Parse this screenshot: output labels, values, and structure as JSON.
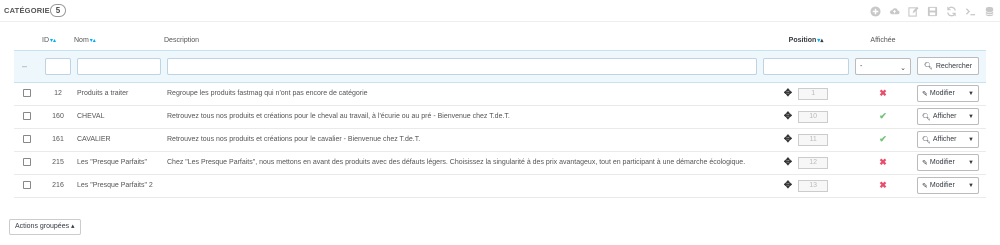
{
  "header": {
    "title": "CATÉGORIES",
    "count": "5"
  },
  "toolbar": {
    "icons": [
      "add-icon",
      "cloud-upload-icon",
      "edit-icon",
      "save-icon",
      "refresh-icon",
      "terminal-icon",
      "database-icon"
    ]
  },
  "columns": {
    "id": "ID",
    "name": "Nom",
    "description": "Description",
    "position": "Position",
    "displayed": "Affichée"
  },
  "filter": {
    "dash": "–",
    "select_value": "-",
    "search_label": "Rechercher"
  },
  "rows": [
    {
      "id": "12",
      "name": "Produits a traiter",
      "description": "Regroupe les produits fastmag qui n'ont pas encore de catégorie",
      "position": "1",
      "displayed": "✖",
      "action": "Modifier",
      "displayed_state": "no"
    },
    {
      "id": "160",
      "name": "CHEVAL",
      "description": "Retrouvez tous nos produits et créations pour le cheval au travail, à l'écurie ou au pré - Bienvenue chez T.de.T.",
      "position": "10",
      "displayed": "✔",
      "action": "Afficher",
      "displayed_state": "yes"
    },
    {
      "id": "161",
      "name": "CAVALIER",
      "description": "Retrouvez tous nos produits et créations pour le cavalier - Bienvenue chez T.de.T.",
      "position": "11",
      "displayed": "✔",
      "action": "Afficher",
      "displayed_state": "yes"
    },
    {
      "id": "215",
      "name": "Les \"Presque Parfaits\"",
      "description": "Chez \"Les Presque Parfaits\", nous mettons en avant des produits avec des défauts légers. Choisissez la singularité à des prix avantageux, tout en participant à une démarche écologique.",
      "position": "12",
      "displayed": "✖",
      "action": "Modifier",
      "displayed_state": "no"
    },
    {
      "id": "216",
      "name": "Les \"Presque Parfaits\" 2",
      "description": "",
      "position": "13",
      "displayed": "✖",
      "action": "Modifier",
      "displayed_state": "no"
    }
  ],
  "bulk": {
    "label": "Actions groupées ▴"
  },
  "colors": {
    "accent": "#00aff0",
    "no": "#e84e6a",
    "yes": "#72c279",
    "filter_bg": "#eef7fc"
  }
}
